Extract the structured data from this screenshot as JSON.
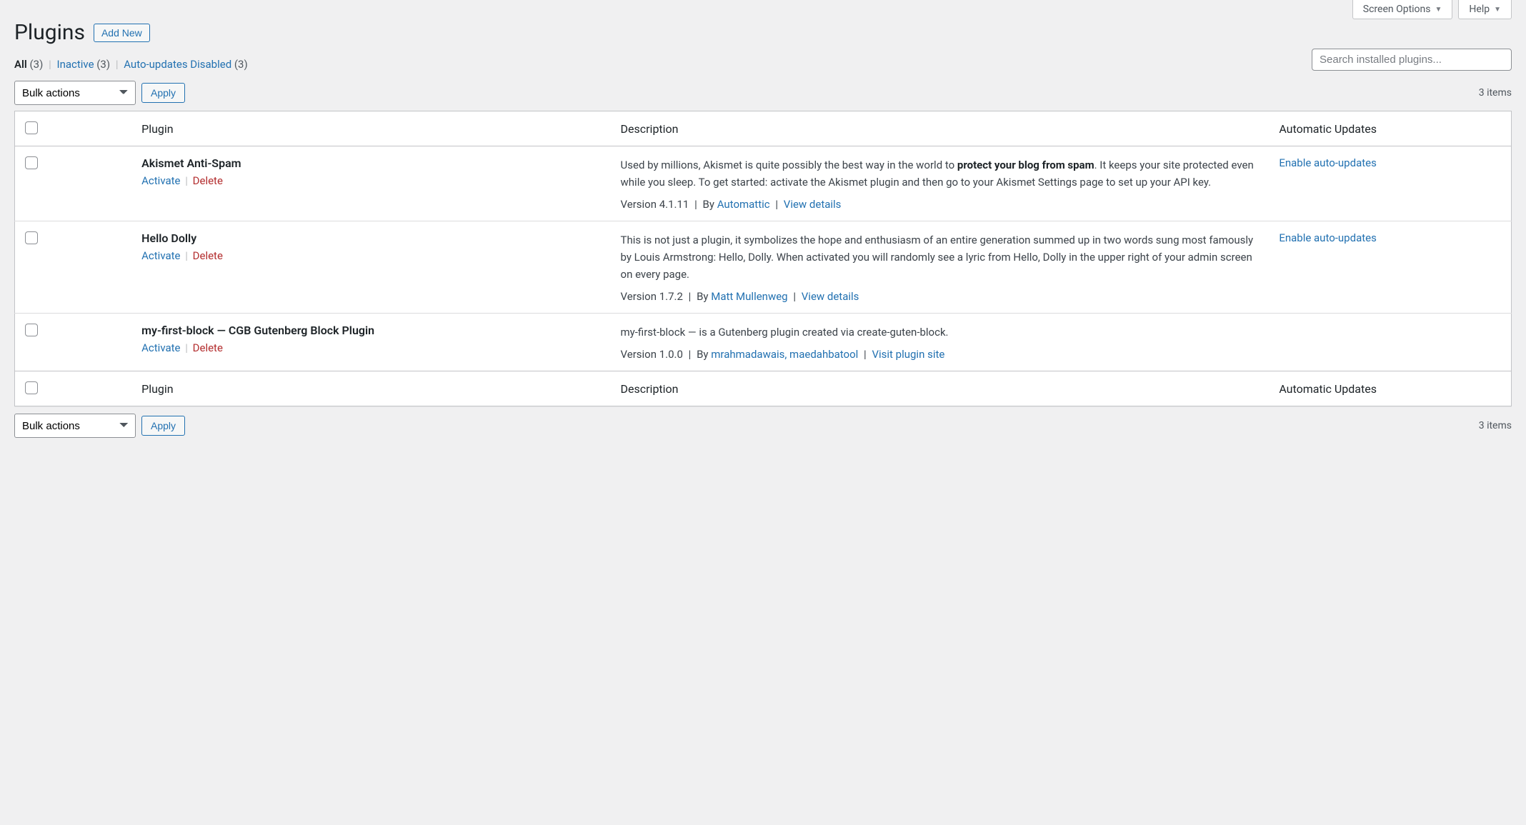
{
  "topTabs": {
    "screenOptions": "Screen Options",
    "help": "Help"
  },
  "header": {
    "title": "Plugins",
    "addNew": "Add New"
  },
  "filters": {
    "all": {
      "label": "All",
      "count": "(3)"
    },
    "inactive": {
      "label": "Inactive",
      "count": "(3)"
    },
    "autoDisabled": {
      "label": "Auto-updates Disabled",
      "count": "(3)"
    }
  },
  "search": {
    "placeholder": "Search installed plugins..."
  },
  "bulk": {
    "label": "Bulk actions",
    "apply": "Apply"
  },
  "itemsCount": "3 items",
  "columns": {
    "plugin": "Plugin",
    "description": "Description",
    "autoUpdates": "Automatic Updates"
  },
  "rowActions": {
    "activate": "Activate",
    "delete": "Delete"
  },
  "meta": {
    "by": "By",
    "viewDetails": "View details",
    "visitSite": "Visit plugin site"
  },
  "autoUpdateLink": "Enable auto-updates",
  "plugins": [
    {
      "name": "Akismet Anti-Spam",
      "descPre": "Used by millions, Akismet is quite possibly the best way in the world to ",
      "descBold": "protect your blog from spam",
      "descPost": ". It keeps your site protected even while you sleep. To get started: activate the Akismet plugin and then go to your Akismet Settings page to set up your API key.",
      "version": "Version 4.1.11",
      "author": "Automattic",
      "detailsLink": "View details",
      "showAuto": true
    },
    {
      "name": "Hello Dolly",
      "descPre": "This is not just a plugin, it symbolizes the hope and enthusiasm of an entire generation summed up in two words sung most famously by Louis Armstrong: Hello, Dolly. When activated you will randomly see a lyric from Hello, Dolly in the upper right of your admin screen on every page.",
      "descBold": "",
      "descPost": "",
      "version": "Version 1.7.2",
      "author": "Matt Mullenweg",
      "detailsLink": "View details",
      "showAuto": true
    },
    {
      "name": "my-first-block — CGB Gutenberg Block Plugin",
      "descPre": "my-first-block — is a Gutenberg plugin created via create-guten-block.",
      "descBold": "",
      "descPost": "",
      "version": "Version 1.0.0",
      "author": "mrahmadawais, maedahbatool",
      "detailsLink": "Visit plugin site",
      "showAuto": false
    }
  ]
}
